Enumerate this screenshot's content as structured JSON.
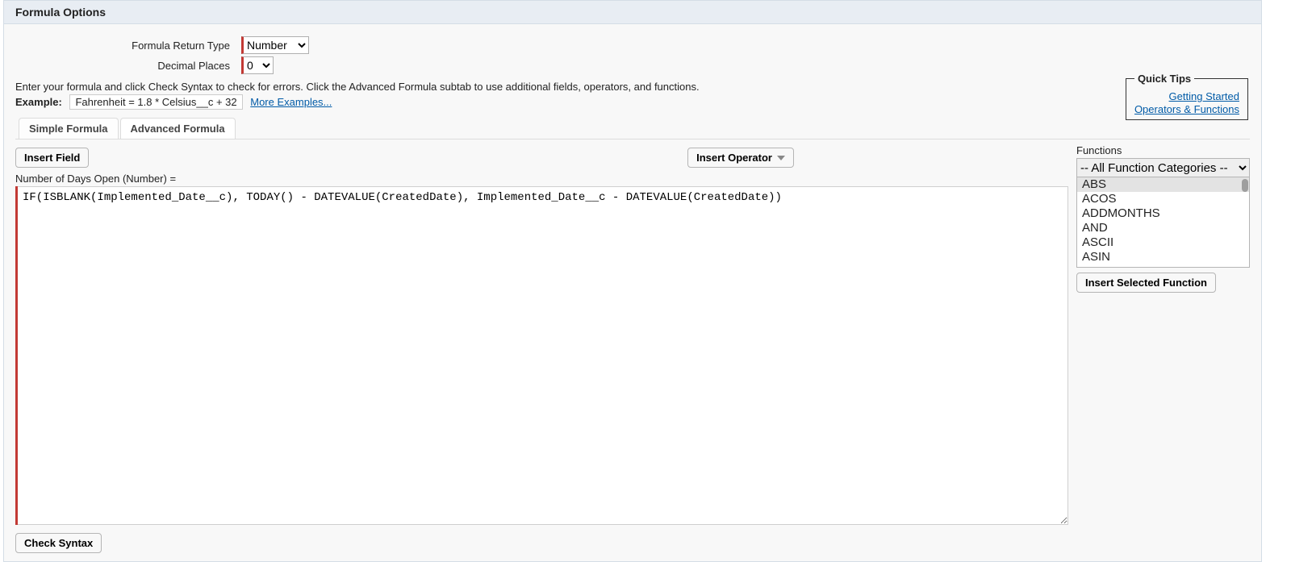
{
  "panel": {
    "title": "Formula Options"
  },
  "form": {
    "return_type_label": "Formula Return Type",
    "return_type_value": "Number",
    "decimal_label": "Decimal Places",
    "decimal_value": "0"
  },
  "quick_tips": {
    "legend": "Quick Tips",
    "link1": "Getting Started",
    "link2": "Operators & Functions"
  },
  "instructions": "Enter your formula and click Check Syntax to check for errors. Click the Advanced Formula subtab to use additional fields, operators, and functions.",
  "example": {
    "label": "Example:",
    "text": "Fahrenheit = 1.8 * Celsius__c + 32",
    "more": "More Examples..."
  },
  "tabs": {
    "simple": "Simple Formula",
    "advanced": "Advanced Formula"
  },
  "toolbar": {
    "insert_field": "Insert Field",
    "insert_operator": "Insert Operator"
  },
  "editor": {
    "field_label": "Number of Days Open (Number) =",
    "formula": "IF(ISBLANK(Implemented_Date__c), TODAY() - DATEVALUE(CreatedDate), Implemented_Date__c - DATEVALUE(CreatedDate))"
  },
  "functions": {
    "title": "Functions",
    "category": "-- All Function Categories --",
    "list": [
      "ABS",
      "ACOS",
      "ADDMONTHS",
      "AND",
      "ASCII",
      "ASIN"
    ],
    "insert_btn": "Insert Selected Function"
  },
  "buttons": {
    "check_syntax": "Check Syntax"
  }
}
